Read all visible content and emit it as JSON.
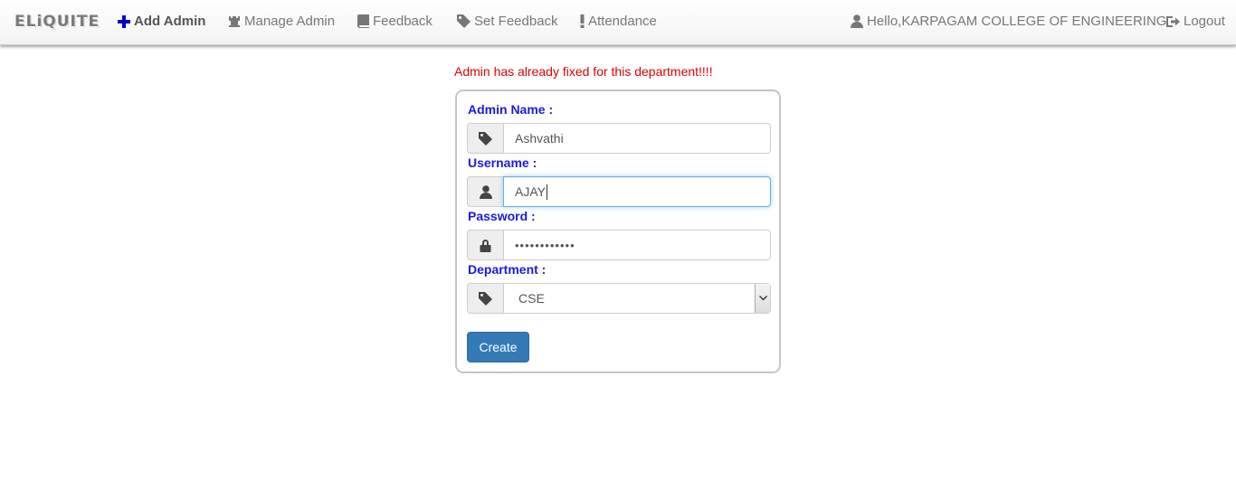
{
  "navbar": {
    "brand": "ELiQUITE",
    "items": [
      {
        "label": "Add Admin",
        "icon": "plus-icon"
      },
      {
        "label": "Manage Admin",
        "icon": "tower-icon"
      },
      {
        "label": "Feedback",
        "icon": "book-icon"
      },
      {
        "label": "Set Feedback",
        "icon": "tag-icon"
      },
      {
        "label": "Attendance",
        "icon": "exclamation-icon"
      }
    ],
    "greeting": "Hello,KARPAGAM COLLEGE OF ENGINEERING",
    "logout": "Logout"
  },
  "message": "Admin has already fixed for this department!!!!",
  "form": {
    "admin_name": {
      "label": "Admin Name :",
      "value": "Ashvathi"
    },
    "username": {
      "label": "Username :",
      "value": "AJAY"
    },
    "password": {
      "label": "Password :",
      "value": "••••••••••••"
    },
    "department": {
      "label": "Department :",
      "value": "CSE"
    },
    "submit": "Create"
  },
  "colors": {
    "label": "#1a1adf",
    "error": "#e00000",
    "primary_button": "#337ab7",
    "add_icon": "#0000cc"
  }
}
